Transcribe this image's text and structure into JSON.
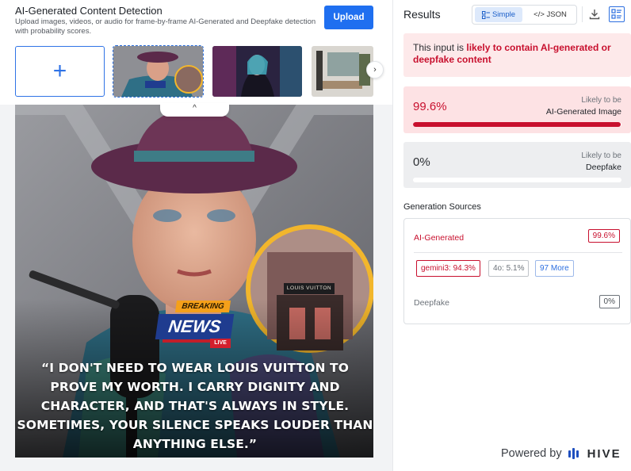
{
  "header": {
    "title": "AI-Generated Content Detection",
    "description": "Upload images, videos, or audio for frame-by-frame AI-Generated and Deepfake detection with probability scores.",
    "upload_label": "Upload",
    "add_symbol": "+",
    "collapse_symbol": "^",
    "next_symbol": "›"
  },
  "thumbnails": [
    {
      "name": "thumbnail-portrait-news",
      "selected": true
    },
    {
      "name": "thumbnail-cyberpunk",
      "selected": false
    },
    {
      "name": "thumbnail-interior",
      "selected": false
    }
  ],
  "preview": {
    "breaking": "BREAKING",
    "news": "NEWS",
    "live": "LIVE",
    "sign_text": "LOUIS VUITTON",
    "quote": "“I DON'T NEED TO WEAR LOUIS VUITTON TO PROVE MY WORTH. I CARRY DIGNITY AND CHARACTER, AND THAT'S ALWAYS IN STYLE. SOMETIMES, YOUR SILENCE SPEAKS LOUDER THAN ANYTHING ELSE.”"
  },
  "results": {
    "title": "Results",
    "view_simple": "Simple",
    "view_json": "</> JSON",
    "verdict_prefix": "This input is ",
    "verdict_emphasis": "likely to contain AI-generated or deepfake content",
    "ai": {
      "score": "99.6%",
      "fraction": 0.996,
      "small": "Likely to be",
      "big": "AI-Generated Image"
    },
    "deepfake": {
      "score": "0%",
      "fraction": 0.0,
      "small": "Likely to be",
      "big": "Deepfake"
    }
  },
  "sources": {
    "title": "Generation Sources",
    "ai_label": "AI-Generated",
    "ai_score": "99.6%",
    "chips": [
      "gemini3: 94.3%",
      "4o: 5.1%",
      "97 More"
    ],
    "deepfake_label": "Deepfake",
    "deepfake_score": "0%"
  },
  "footer": {
    "powered_by": "Powered by",
    "brand": "HIVE"
  },
  "colors": {
    "accent": "#1f6ff0",
    "danger": "#c8102e",
    "danger_bg": "#fde2e4"
  },
  "icons": [
    "plus-icon",
    "chevron-right-icon",
    "chevron-up-icon",
    "simple-view-icon",
    "download-icon",
    "layout-icon",
    "hive-logo-icon"
  ]
}
